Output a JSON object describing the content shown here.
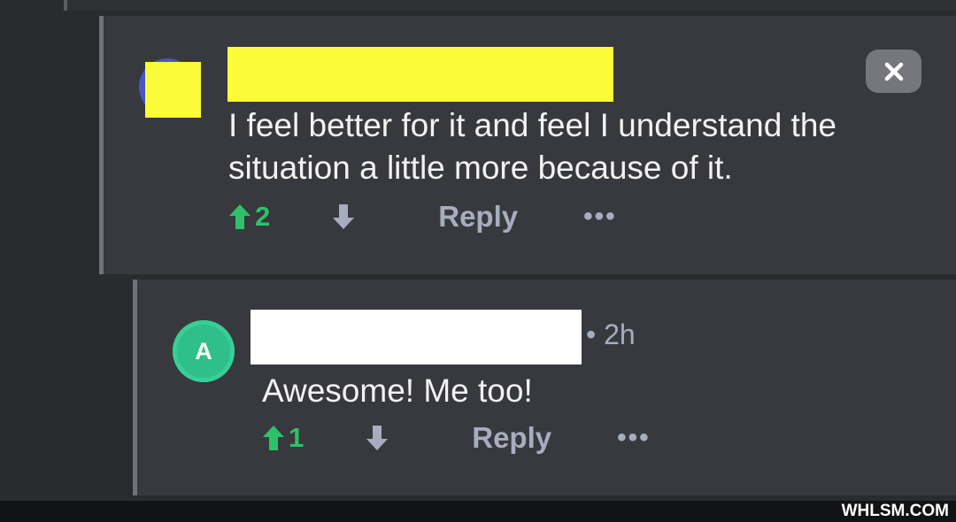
{
  "comments": [
    {
      "text": "I feel better for it and feel I understand the situation a little more because of it.",
      "upvotes": "2",
      "reply_label": "Reply",
      "more_label": "•••"
    },
    {
      "avatar_letter": "A",
      "time_meta": "• 2h",
      "text": "Awesome! Me too!",
      "upvotes": "1",
      "reply_label": "Reply",
      "more_label": "•••"
    }
  ],
  "watermark": "WHLSM.COM",
  "colors": {
    "background": "#2a2b2f",
    "card": "#38393e",
    "upvote": "#2cc16a",
    "muted": "#a7adbf",
    "redact_yellow": "#fbfb3a",
    "avatar_green": "#2fbf8a"
  }
}
